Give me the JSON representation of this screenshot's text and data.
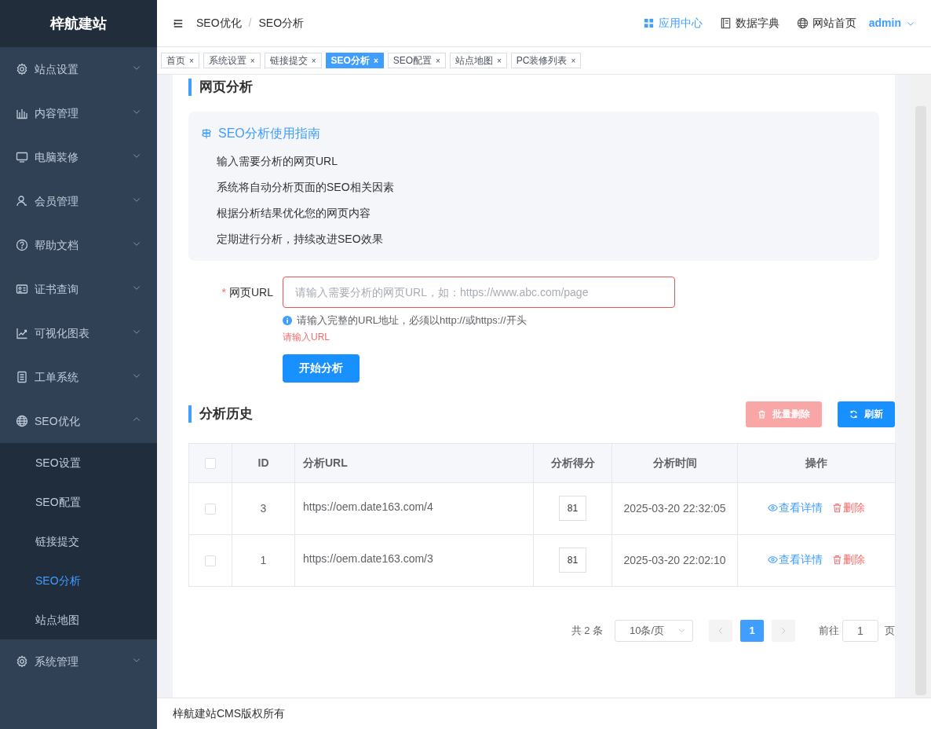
{
  "sidebar": {
    "title": "梓航建站",
    "items": [
      {
        "label": "站点设置",
        "expanded": false
      },
      {
        "label": "内容管理",
        "expanded": false
      },
      {
        "label": "电脑装修",
        "expanded": false
      },
      {
        "label": "会员管理",
        "expanded": false
      },
      {
        "label": "帮助文档",
        "expanded": false
      },
      {
        "label": "证书查询",
        "expanded": false
      },
      {
        "label": "可视化图表",
        "expanded": false
      },
      {
        "label": "工单系统",
        "expanded": false
      },
      {
        "label": "SEO优化",
        "expanded": true,
        "children": [
          {
            "label": "SEO设置",
            "selected": false
          },
          {
            "label": "SEO配置",
            "selected": false
          },
          {
            "label": "链接提交",
            "selected": false
          },
          {
            "label": "SEO分析",
            "selected": true
          },
          {
            "label": "站点地图",
            "selected": false
          }
        ]
      },
      {
        "label": "系统管理",
        "expanded": false
      }
    ]
  },
  "header": {
    "breadcrumb": [
      "SEO优化",
      "SEO分析"
    ],
    "separator": "/",
    "actions": [
      {
        "label": "应用中心",
        "selected": true
      },
      {
        "label": "数据字典",
        "selected": false
      },
      {
        "label": "网站首页",
        "selected": false
      }
    ],
    "user": "admin"
  },
  "tabs": [
    {
      "label": "首页",
      "selected": false
    },
    {
      "label": "系统设置",
      "selected": false
    },
    {
      "label": "链接提交",
      "selected": false
    },
    {
      "label": "SEO分析",
      "selected": true
    },
    {
      "label": "SEO配置",
      "selected": false
    },
    {
      "label": "站点地图",
      "selected": false
    },
    {
      "label": "PC装修列表",
      "selected": false
    }
  ],
  "tab_close": "×",
  "section_title": "网页分析",
  "guide": {
    "title": "SEO分析使用指南",
    "items": [
      "输入需要分析的网页URL",
      "系统将自动分析页面的SEO相关因素",
      "根据分析结果优化您的网页内容",
      "定期进行分析，持续改进SEO效果"
    ]
  },
  "form": {
    "label": "网页URL",
    "required": true,
    "required_mark": "*",
    "placeholder": "请输入需要分析的网页URL，如：https://www.abc.com/page",
    "hint": "请输入完整的URL地址，必须以http://或https://开头",
    "error": "请输入URL",
    "submit": "开始分析"
  },
  "history": {
    "title": "分析历史",
    "buttons": [
      {
        "label": "批量删除",
        "kind": "danger",
        "disabled": true
      },
      {
        "label": "刷新",
        "kind": "primary",
        "disabled": false
      }
    ],
    "table": {
      "select_all_checked": false,
      "columns": [
        "ID",
        "分析URL",
        "分析得分",
        "分析时间",
        "操作"
      ],
      "rows": [
        {
          "checked": false,
          "id": "3",
          "url": "https://oem.date163.com/4",
          "score": "81",
          "time": "2025-03-20 22:32:05",
          "actions": [
            "查看详情",
            "删除"
          ]
        },
        {
          "checked": false,
          "id": "1",
          "url": "https://oem.date163.com/3",
          "score": "81",
          "time": "2025-03-20 22:02:10",
          "actions": [
            "查看详情",
            "删除"
          ]
        }
      ]
    }
  },
  "pagination": {
    "total": "共 2 条",
    "page_size": "10条/页",
    "pages": [
      {
        "label": "1",
        "selected": true
      }
    ],
    "prev_disabled": true,
    "next_disabled": true,
    "goto_label": "前往",
    "goto_value": "1",
    "goto_suffix": "页"
  },
  "footer": "梓航建站CMS版权所有"
}
